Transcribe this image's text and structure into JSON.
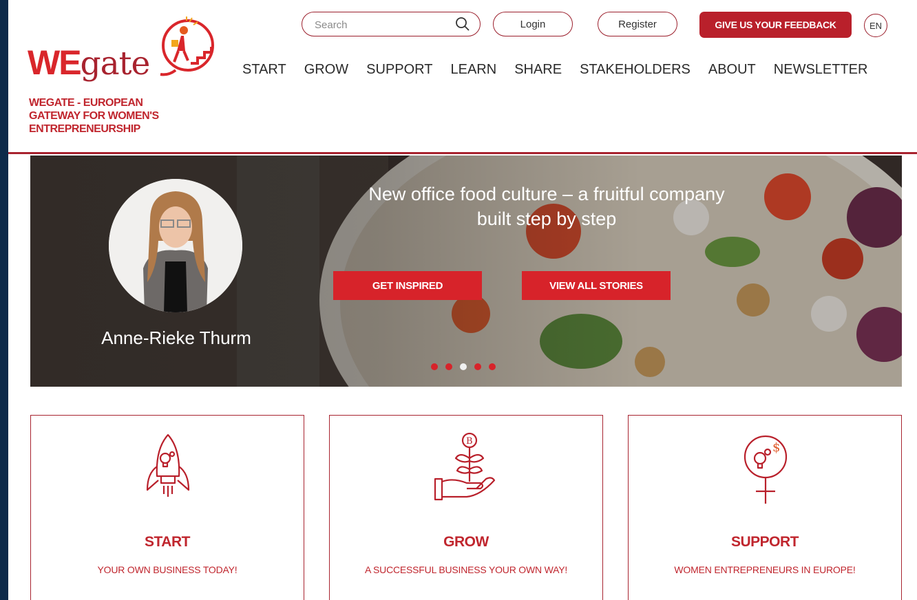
{
  "header": {
    "logo": {
      "we": "WE",
      "gate": "gate"
    },
    "tagline_lines": [
      "WEGATE - EUROPEAN",
      "GATEWAY FOR WOMEN'S",
      "ENTREPRENEURSHIP"
    ],
    "search": {
      "placeholder": "Search",
      "icon": "search-icon"
    },
    "login_label": "Login",
    "register_label": "Register",
    "feedback_label": "GIVE US YOUR FEEDBACK",
    "language": "EN"
  },
  "nav": {
    "items": [
      {
        "label": "START"
      },
      {
        "label": "GROW"
      },
      {
        "label": "SUPPORT"
      },
      {
        "label": "LEARN"
      },
      {
        "label": "SHARE"
      },
      {
        "label": "STAKEHOLDERS"
      },
      {
        "label": "ABOUT"
      },
      {
        "label": "NEWSLETTER"
      }
    ]
  },
  "hero": {
    "title_lines": [
      "New office food culture – a fruitful company",
      "built step by step"
    ],
    "person_name": "Anne-Rieke Thurm",
    "inspired_label": "GET INSPIRED",
    "stories_label": "VIEW ALL STORIES",
    "slides_count": 5,
    "active_slide": 3
  },
  "cards": [
    {
      "title": "START",
      "subtitle": "YOUR OWN BUSINESS TODAY!",
      "icon": "rocket-lightbulb-icon"
    },
    {
      "title": "GROW",
      "subtitle": "A SUCCESSFUL BUSINESS YOUR OWN WAY!",
      "icon": "hand-plant-coin-icon"
    },
    {
      "title": "SUPPORT",
      "subtitle": "WOMEN ENTREPRENEURS IN EUROPE!",
      "icon": "female-symbol-idea-icon"
    }
  ],
  "colors": {
    "brand_red": "#c0262e",
    "button_red": "#d7232a",
    "frame_navy": "#0d2a4a"
  }
}
